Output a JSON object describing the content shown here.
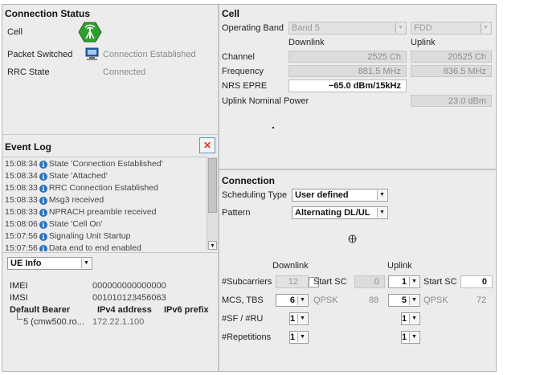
{
  "connection_status": {
    "title": "Connection Status",
    "cell_label": "Cell",
    "packet_label": "Packet Switched",
    "packet_value": "Connection Established",
    "rrc_label": "RRC State",
    "rrc_value": "Connected"
  },
  "cell": {
    "title": "Cell",
    "operating_band_label": "Operating Band",
    "band_value": "Band 5",
    "duplex_value": "FDD",
    "downlink_header": "Downlink",
    "uplink_header": "Uplink",
    "channel_label": "Channel",
    "channel_dl": "2525 Ch",
    "channel_ul": "20525 Ch",
    "frequency_label": "Frequency",
    "frequency_dl": "881.5 MHz",
    "frequency_ul": "836.5 MHz",
    "nrs_label": "NRS EPRE",
    "nrs_value": "−65.0 dBm/15kHz",
    "ul_power_label": "Uplink Nominal Power",
    "ul_power_value": "23.0 dBm"
  },
  "event_log": {
    "title": "Event Log",
    "close_glyph": "✕",
    "entries": [
      {
        "time": "15:08:34",
        "text": "State 'Connection Established'"
      },
      {
        "time": "15:08:34",
        "text": "State 'Attached'"
      },
      {
        "time": "15:08:33",
        "text": "RRC Connection Established"
      },
      {
        "time": "15:08:33",
        "text": "Msg3 received"
      },
      {
        "time": "15:08:33",
        "text": "NPRACH preamble received"
      },
      {
        "time": "15:08:06",
        "text": "State 'Cell On'"
      },
      {
        "time": "15:07:56",
        "text": "Signaling Unit Startup"
      },
      {
        "time": "15:07:56",
        "text": "Data end to end enabled"
      }
    ]
  },
  "connection": {
    "title": "Connection",
    "scheduling_label": "Scheduling Type",
    "scheduling_value": "User defined",
    "pattern_label": "Pattern",
    "pattern_value": "Alternating DL/UL",
    "downlink_header": "Downlink",
    "uplink_header": "Uplink",
    "subcarriers_label": "#Subcarriers",
    "subcarriers_dl": "12",
    "start_sc_label": "Start SC",
    "start_sc_dl": "0",
    "subcarriers_ul": "1",
    "start_sc_ul": "0",
    "mcs_label": "MCS, TBS",
    "mcs_dl": "6",
    "mod_dl": "QPSK",
    "tbs_dl": "88",
    "mcs_ul": "5",
    "mod_ul": "QPSK",
    "tbs_ul": "72",
    "sf_label": "#SF / #RU",
    "sf_dl": "1",
    "sf_ul": "1",
    "rep_label": "#Repetitions",
    "rep_dl": "1",
    "rep_ul": "1"
  },
  "ue_info": {
    "selector_value": "UE Info",
    "imei_label": "IMEI",
    "imei_value": "000000000000000",
    "imsi_label": "IMSI",
    "imsi_value": "001010123456063",
    "bearer_header": "Default Bearer",
    "ipv4_header": "IPv4 address",
    "ipv6_header": "IPv6 prefix",
    "bearer_name": "5 (cmw500.ro...",
    "bearer_ipv4": "172.22.1.100"
  },
  "icons": {
    "cell_icon": "antenna-tower-icon",
    "packet_icon": "computer-icon",
    "info_icon": "info-icon",
    "dropdown_glyph": "▼"
  },
  "colors": {
    "cell_icon_green": "#2f9e2f",
    "close_red": "#d33",
    "info_blue": "#2a6fbf"
  }
}
